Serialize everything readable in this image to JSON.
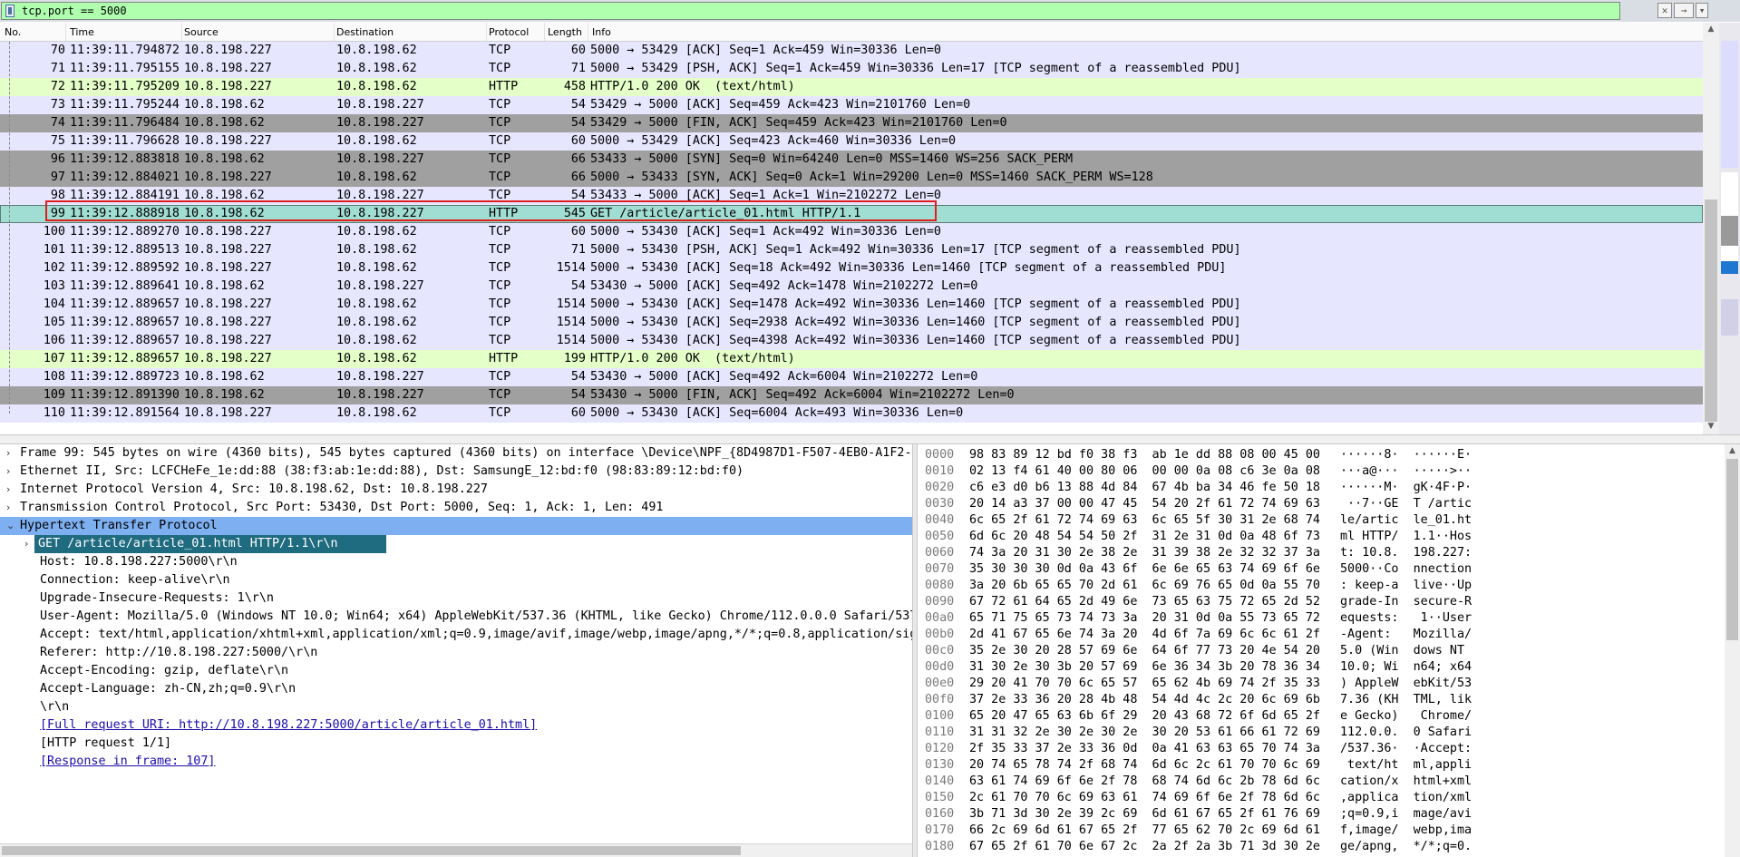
{
  "filter": {
    "expression": "tcp.port == 5000",
    "clear_symbol": "✕",
    "apply_symbol": "→",
    "dropdown_symbol": "▾"
  },
  "packet_list": {
    "columns": [
      "No.",
      "Time",
      "Source",
      "Destination",
      "Protocol",
      "Length",
      "Info"
    ],
    "rows": [
      {
        "no": "70",
        "time": "11:39:11.794872",
        "src": "10.8.198.227",
        "dst": "10.8.198.62",
        "proto": "TCP",
        "len": "60",
        "info": "5000 → 53429 [ACK] Seq=1 Ack=459 Win=30336 Len=0",
        "style": "tcp"
      },
      {
        "no": "71",
        "time": "11:39:11.795155",
        "src": "10.8.198.227",
        "dst": "10.8.198.62",
        "proto": "TCP",
        "len": "71",
        "info": "5000 → 53429 [PSH, ACK] Seq=1 Ack=459 Win=30336 Len=17 [TCP segment of a reassembled PDU]",
        "style": "tcp"
      },
      {
        "no": "72",
        "time": "11:39:11.795209",
        "src": "10.8.198.227",
        "dst": "10.8.198.62",
        "proto": "HTTP",
        "len": "458",
        "info": "HTTP/1.0 200 OK  (text/html)",
        "style": "http"
      },
      {
        "no": "73",
        "time": "11:39:11.795244",
        "src": "10.8.198.62",
        "dst": "10.8.198.227",
        "proto": "TCP",
        "len": "54",
        "info": "53429 → 5000 [ACK] Seq=459 Ack=423 Win=2101760 Len=0",
        "style": "tcp"
      },
      {
        "no": "74",
        "time": "11:39:11.796484",
        "src": "10.8.198.62",
        "dst": "10.8.198.227",
        "proto": "TCP",
        "len": "54",
        "info": "53429 → 5000 [FIN, ACK] Seq=459 Ack=423 Win=2101760 Len=0",
        "style": "dark"
      },
      {
        "no": "75",
        "time": "11:39:11.796628",
        "src": "10.8.198.227",
        "dst": "10.8.198.62",
        "proto": "TCP",
        "len": "60",
        "info": "5000 → 53429 [ACK] Seq=423 Ack=460 Win=30336 Len=0",
        "style": "tcp"
      },
      {
        "no": "96",
        "time": "11:39:12.883818",
        "src": "10.8.198.62",
        "dst": "10.8.198.227",
        "proto": "TCP",
        "len": "66",
        "info": "53433 → 5000 [SYN] Seq=0 Win=64240 Len=0 MSS=1460 WS=256 SACK_PERM",
        "style": "dark"
      },
      {
        "no": "97",
        "time": "11:39:12.884021",
        "src": "10.8.198.227",
        "dst": "10.8.198.62",
        "proto": "TCP",
        "len": "66",
        "info": "5000 → 53433 [SYN, ACK] Seq=0 Ack=1 Win=29200 Len=0 MSS=1460 SACK_PERM WS=128",
        "style": "dark"
      },
      {
        "no": "98",
        "time": "11:39:12.884191",
        "src": "10.8.198.62",
        "dst": "10.8.198.227",
        "proto": "TCP",
        "len": "54",
        "info": "53433 → 5000 [ACK] Seq=1 Ack=1 Win=2102272 Len=0",
        "style": "tcp"
      },
      {
        "no": "99",
        "time": "11:39:12.888918",
        "src": "10.8.198.62",
        "dst": "10.8.198.227",
        "proto": "HTTP",
        "len": "545",
        "info": "GET /article/article_01.html HTTP/1.1",
        "style": "sel"
      },
      {
        "no": "100",
        "time": "11:39:12.889270",
        "src": "10.8.198.227",
        "dst": "10.8.198.62",
        "proto": "TCP",
        "len": "60",
        "info": "5000 → 53430 [ACK] Seq=1 Ack=492 Win=30336 Len=0",
        "style": "tcp"
      },
      {
        "no": "101",
        "time": "11:39:12.889513",
        "src": "10.8.198.227",
        "dst": "10.8.198.62",
        "proto": "TCP",
        "len": "71",
        "info": "5000 → 53430 [PSH, ACK] Seq=1 Ack=492 Win=30336 Len=17 [TCP segment of a reassembled PDU]",
        "style": "tcp"
      },
      {
        "no": "102",
        "time": "11:39:12.889592",
        "src": "10.8.198.227",
        "dst": "10.8.198.62",
        "proto": "TCP",
        "len": "1514",
        "info": "5000 → 53430 [ACK] Seq=18 Ack=492 Win=30336 Len=1460 [TCP segment of a reassembled PDU]",
        "style": "tcp"
      },
      {
        "no": "103",
        "time": "11:39:12.889641",
        "src": "10.8.198.62",
        "dst": "10.8.198.227",
        "proto": "TCP",
        "len": "54",
        "info": "53430 → 5000 [ACK] Seq=492 Ack=1478 Win=2102272 Len=0",
        "style": "tcp"
      },
      {
        "no": "104",
        "time": "11:39:12.889657",
        "src": "10.8.198.227",
        "dst": "10.8.198.62",
        "proto": "TCP",
        "len": "1514",
        "info": "5000 → 53430 [ACK] Seq=1478 Ack=492 Win=30336 Len=1460 [TCP segment of a reassembled PDU]",
        "style": "tcp"
      },
      {
        "no": "105",
        "time": "11:39:12.889657",
        "src": "10.8.198.227",
        "dst": "10.8.198.62",
        "proto": "TCP",
        "len": "1514",
        "info": "5000 → 53430 [ACK] Seq=2938 Ack=492 Win=30336 Len=1460 [TCP segment of a reassembled PDU]",
        "style": "tcp"
      },
      {
        "no": "106",
        "time": "11:39:12.889657",
        "src": "10.8.198.227",
        "dst": "10.8.198.62",
        "proto": "TCP",
        "len": "1514",
        "info": "5000 → 53430 [ACK] Seq=4398 Ack=492 Win=30336 Len=1460 [TCP segment of a reassembled PDU]",
        "style": "tcp"
      },
      {
        "no": "107",
        "time": "11:39:12.889657",
        "src": "10.8.198.227",
        "dst": "10.8.198.62",
        "proto": "HTTP",
        "len": "199",
        "info": "HTTP/1.0 200 OK  (text/html)",
        "style": "http"
      },
      {
        "no": "108",
        "time": "11:39:12.889723",
        "src": "10.8.198.62",
        "dst": "10.8.198.227",
        "proto": "TCP",
        "len": "54",
        "info": "53430 → 5000 [ACK] Seq=492 Ack=6004 Win=2102272 Len=0",
        "style": "tcp"
      },
      {
        "no": "109",
        "time": "11:39:12.891390",
        "src": "10.8.198.62",
        "dst": "10.8.198.227",
        "proto": "TCP",
        "len": "54",
        "info": "53430 → 5000 [FIN, ACK] Seq=492 Ack=6004 Win=2102272 Len=0",
        "style": "dark"
      },
      {
        "no": "110",
        "time": "11:39:12.891564",
        "src": "10.8.198.227",
        "dst": "10.8.198.62",
        "proto": "TCP",
        "len": "60",
        "info": "5000 → 53430 [ACK] Seq=6004 Ack=493 Win=30336 Len=0",
        "style": "tcp"
      }
    ]
  },
  "details": [
    {
      "exp": "›",
      "text": "Frame 99: 545 bytes on wire (4360 bits), 545 bytes captured (4360 bits) on interface \\Device\\NPF_{8D4987D1-F507-4EB0-A1F2-5",
      "indent": 0
    },
    {
      "exp": "›",
      "text": "Ethernet II, Src: LCFCHeFe_1e:dd:88 (38:f3:ab:1e:dd:88), Dst: SamsungE_12:bd:f0 (98:83:89:12:bd:f0)",
      "indent": 0
    },
    {
      "exp": "›",
      "text": "Internet Protocol Version 4, Src: 10.8.198.62, Dst: 10.8.198.227",
      "indent": 0
    },
    {
      "exp": "›",
      "text": "Transmission Control Protocol, Src Port: 53430, Dst Port: 5000, Seq: 1, Ack: 1, Len: 491",
      "indent": 0
    },
    {
      "exp": "⌄",
      "text": "Hypertext Transfer Protocol",
      "indent": 0,
      "hl": true
    },
    {
      "exp": "›",
      "text": "GET /article/article_01.html HTTP/1.1\\r\\n",
      "indent": 1,
      "sel": true
    },
    {
      "exp": "",
      "text": "Host: 10.8.198.227:5000\\r\\n",
      "indent": 2
    },
    {
      "exp": "",
      "text": "Connection: keep-alive\\r\\n",
      "indent": 2
    },
    {
      "exp": "",
      "text": "Upgrade-Insecure-Requests: 1\\r\\n",
      "indent": 2
    },
    {
      "exp": "",
      "text": "User-Agent: Mozilla/5.0 (Windows NT 10.0; Win64; x64) AppleWebKit/537.36 (KHTML, like Gecko) Chrome/112.0.0.0 Safari/537",
      "indent": 2
    },
    {
      "exp": "",
      "text": "Accept: text/html,application/xhtml+xml,application/xml;q=0.9,image/avif,image/webp,image/apng,*/*;q=0.8,application/sig",
      "indent": 2
    },
    {
      "exp": "",
      "text": "Referer: http://10.8.198.227:5000/\\r\\n",
      "indent": 2
    },
    {
      "exp": "",
      "text": "Accept-Encoding: gzip, deflate\\r\\n",
      "indent": 2
    },
    {
      "exp": "",
      "text": "Accept-Language: zh-CN,zh;q=0.9\\r\\n",
      "indent": 2
    },
    {
      "exp": "",
      "text": "\\r\\n",
      "indent": 2
    },
    {
      "exp": "",
      "text": "[Full request URI: http://10.8.198.227:5000/article/article_01.html]",
      "indent": 2,
      "link": true
    },
    {
      "exp": "",
      "text": "[HTTP request 1/1]",
      "indent": 2
    },
    {
      "exp": "",
      "text": "[Response in frame: 107]",
      "indent": 2,
      "link": true
    }
  ],
  "bytes": [
    {
      "off": "0000",
      "hex": "98 83 89 12 bd f0 38 f3  ab 1e dd 88 08 00 45 00",
      "asc": "······8·  ······E·"
    },
    {
      "off": "0010",
      "hex": "02 13 f4 61 40 00 80 06  00 00 0a 08 c6 3e 0a 08",
      "asc": "···a@···  ·····>··"
    },
    {
      "off": "0020",
      "hex": "c6 e3 d0 b6 13 88 4d 84  67 4b ba 34 46 fe 50 18",
      "asc": "······M·  gK·4F·P·"
    },
    {
      "off": "0030",
      "hex": "20 14 a3 37 00 00 47 45  54 20 2f 61 72 74 69 63",
      "asc": " ··7··GE  T /artic"
    },
    {
      "off": "0040",
      "hex": "6c 65 2f 61 72 74 69 63  6c 65 5f 30 31 2e 68 74",
      "asc": "le/artic  le_01.ht"
    },
    {
      "off": "0050",
      "hex": "6d 6c 20 48 54 54 50 2f  31 2e 31 0d 0a 48 6f 73",
      "asc": "ml HTTP/  1.1··Hos"
    },
    {
      "off": "0060",
      "hex": "74 3a 20 31 30 2e 38 2e  31 39 38 2e 32 32 37 3a",
      "asc": "t: 10.8.  198.227:"
    },
    {
      "off": "0070",
      "hex": "35 30 30 30 0d 0a 43 6f  6e 6e 65 63 74 69 6f 6e",
      "asc": "5000··Co  nnection"
    },
    {
      "off": "0080",
      "hex": "3a 20 6b 65 65 70 2d 61  6c 69 76 65 0d 0a 55 70",
      "asc": ": keep-a  live··Up"
    },
    {
      "off": "0090",
      "hex": "67 72 61 64 65 2d 49 6e  73 65 63 75 72 65 2d 52",
      "asc": "grade-In  secure-R"
    },
    {
      "off": "00a0",
      "hex": "65 71 75 65 73 74 73 3a  20 31 0d 0a 55 73 65 72",
      "asc": "equests:   1··User"
    },
    {
      "off": "00b0",
      "hex": "2d 41 67 65 6e 74 3a 20  4d 6f 7a 69 6c 6c 61 2f",
      "asc": "-Agent:   Mozilla/"
    },
    {
      "off": "00c0",
      "hex": "35 2e 30 20 28 57 69 6e  64 6f 77 73 20 4e 54 20",
      "asc": "5.0 (Win  dows NT "
    },
    {
      "off": "00d0",
      "hex": "31 30 2e 30 3b 20 57 69  6e 36 34 3b 20 78 36 34",
      "asc": "10.0; Wi  n64; x64"
    },
    {
      "off": "00e0",
      "hex": "29 20 41 70 70 6c 65 57  65 62 4b 69 74 2f 35 33",
      "asc": ") AppleW  ebKit/53"
    },
    {
      "off": "00f0",
      "hex": "37 2e 33 36 20 28 4b 48  54 4d 4c 2c 20 6c 69 6b",
      "asc": "7.36 (KH  TML, lik"
    },
    {
      "off": "0100",
      "hex": "65 20 47 65 63 6b 6f 29  20 43 68 72 6f 6d 65 2f",
      "asc": "e Gecko)   Chrome/"
    },
    {
      "off": "0110",
      "hex": "31 31 32 2e 30 2e 30 2e  30 20 53 61 66 61 72 69",
      "asc": "112.0.0.  0 Safari"
    },
    {
      "off": "0120",
      "hex": "2f 35 33 37 2e 33 36 0d  0a 41 63 63 65 70 74 3a",
      "asc": "/537.36·  ·Accept:"
    },
    {
      "off": "0130",
      "hex": "20 74 65 78 74 2f 68 74  6d 6c 2c 61 70 70 6c 69",
      "asc": " text/ht  ml,appli"
    },
    {
      "off": "0140",
      "hex": "63 61 74 69 6f 6e 2f 78  68 74 6d 6c 2b 78 6d 6c",
      "asc": "cation/x  html+xml"
    },
    {
      "off": "0150",
      "hex": "2c 61 70 70 6c 69 63 61  74 69 6f 6e 2f 78 6d 6c",
      "asc": ",applica  tion/xml"
    },
    {
      "off": "0160",
      "hex": "3b 71 3d 30 2e 39 2c 69  6d 61 67 65 2f 61 76 69",
      "asc": ";q=0.9,i  mage/avi"
    },
    {
      "off": "0170",
      "hex": "66 2c 69 6d 61 67 65 2f  77 65 62 70 2c 69 6d 61",
      "asc": "f,image/  webp,ima"
    },
    {
      "off": "0180",
      "hex": "67 65 2f 61 70 6e 67 2c  2a 2f 2a 3b 71 3d 30 2e",
      "asc": "ge/apng,  */*;q=0."
    }
  ]
}
